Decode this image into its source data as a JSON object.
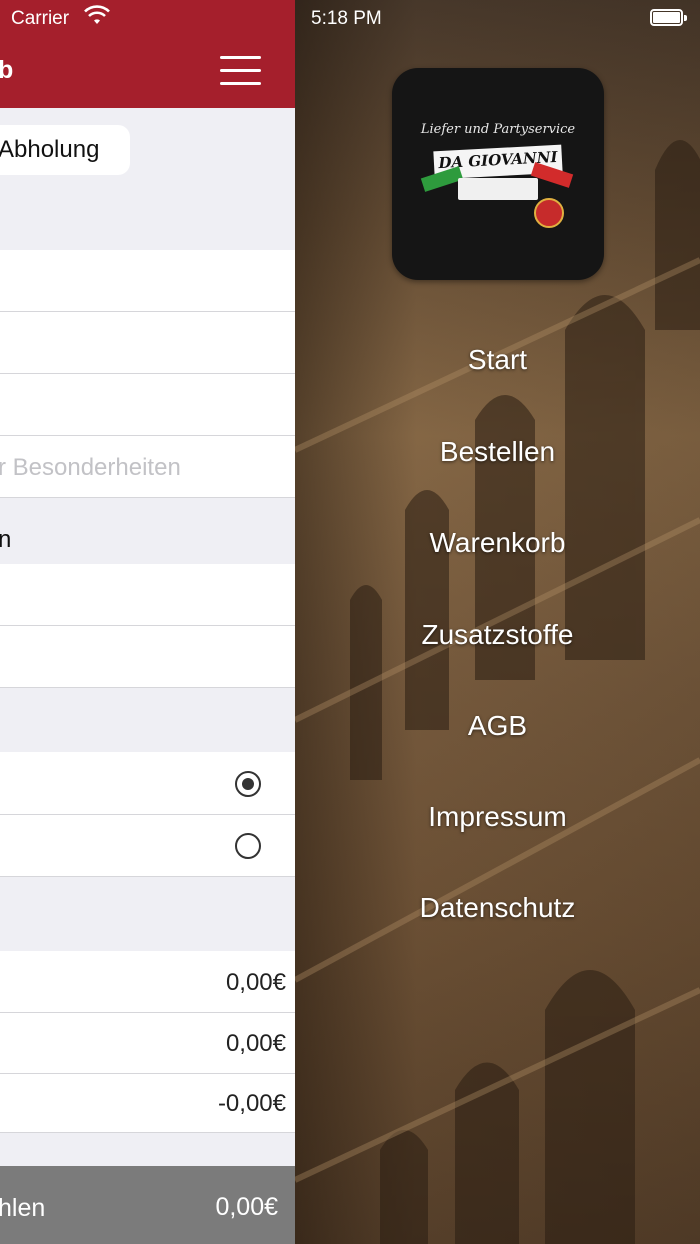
{
  "status_bar": {
    "carrier": "Carrier",
    "time": "5:18 PM"
  },
  "main": {
    "nav_title": "b",
    "segment_label": "Abholung",
    "note_placeholder": "r Besonderheiten",
    "section_label": "n",
    "totals": [
      "0,00€",
      "0,00€",
      "-0,00€"
    ],
    "pay_label": "hlen",
    "pay_amount": "0,00€"
  },
  "side_menu": {
    "logo": {
      "line1": "Liefer und Partyservice",
      "line2": "DA GIOVANNI"
    },
    "items": [
      {
        "label": "Start"
      },
      {
        "label": "Bestellen"
      },
      {
        "label": "Warenkorb"
      },
      {
        "label": "Zusatzstoffe"
      },
      {
        "label": "AGB"
      },
      {
        "label": "Impressum"
      },
      {
        "label": "Datenschutz"
      }
    ]
  },
  "colors": {
    "brand": "#a51f2c",
    "pay_bar": "#7b7b7b"
  }
}
